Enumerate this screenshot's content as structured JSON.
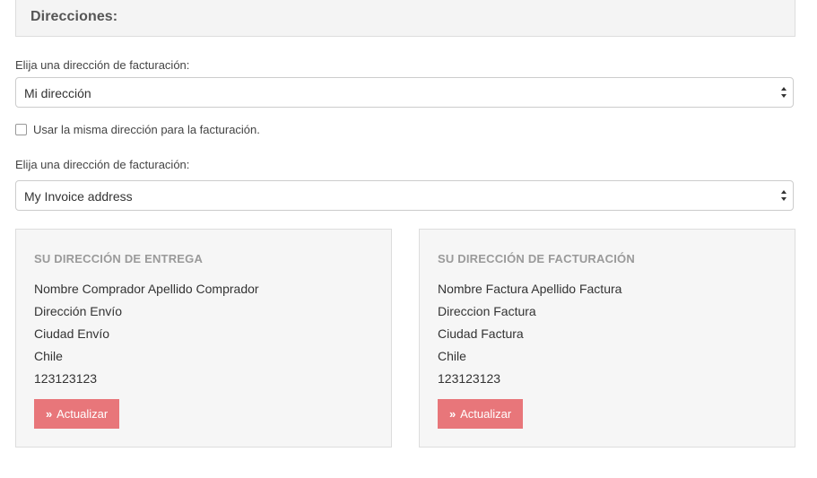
{
  "section": {
    "title": "Direcciones:"
  },
  "delivery_select": {
    "label": "Elija una dirección de facturación:",
    "value": "Mi dirección"
  },
  "same_address": {
    "label": "Usar la misma dirección para la facturación.",
    "checked": false
  },
  "invoice_select": {
    "label": "Elija una dirección de facturación:",
    "value": "My Invoice address"
  },
  "delivery_card": {
    "title": "SU DIRECCIÓN DE ENTREGA",
    "name": "Nombre Comprador Apellido Comprador",
    "address": "Dirección Envío",
    "city": "Ciudad Envío",
    "country": "Chile",
    "phone": "123123123",
    "button_chevron": "»",
    "button_label": "Actualizar"
  },
  "invoice_card": {
    "title": "SU DIRECCIÓN DE FACTURACIÓN",
    "name": "Nombre Factura Apellido Factura",
    "address": "Direccion Factura",
    "city": "Ciudad Factura",
    "country": "Chile",
    "phone": "123123123",
    "button_chevron": "»",
    "button_label": "Actualizar"
  },
  "colors": {
    "button_bg": "#e8767a",
    "card_bg": "#f6f6f6",
    "header_bg": "#f4f4f4"
  }
}
